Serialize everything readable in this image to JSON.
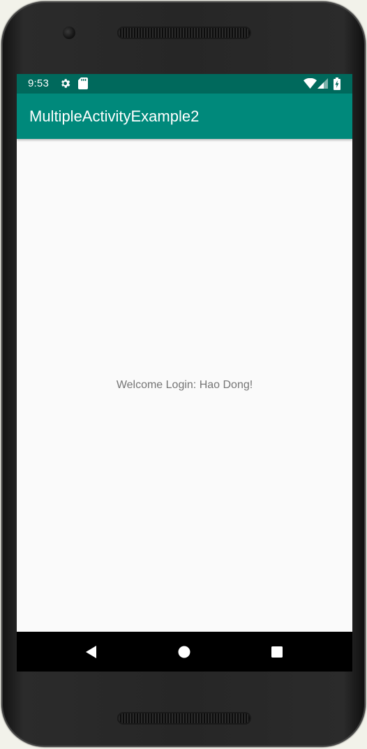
{
  "status_bar": {
    "time": "9:53",
    "icons": [
      "settings-icon",
      "sd-card-icon",
      "wifi-icon",
      "signal-icon",
      "battery-icon"
    ]
  },
  "app_bar": {
    "title": "MultipleActivityExample2"
  },
  "content": {
    "welcome_text": "Welcome Login: Hao Dong!"
  },
  "nav_bar": {
    "buttons": [
      "back-icon",
      "home-icon",
      "recents-icon"
    ]
  },
  "colors": {
    "status_bar": "#00695c",
    "app_bar": "#00897b",
    "background": "#fafafa",
    "welcome_text": "#757575"
  }
}
